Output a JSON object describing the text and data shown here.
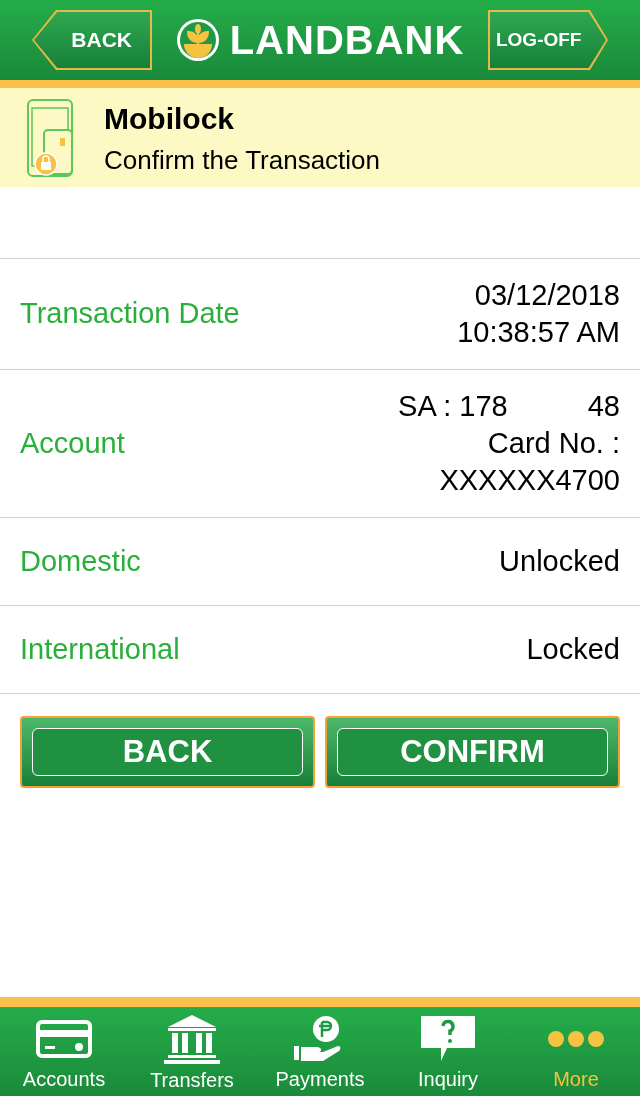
{
  "header": {
    "back": "BACK",
    "logo": "LANDBANK",
    "logoff": "LOG-OFF"
  },
  "banner": {
    "title": "Mobilock",
    "subtitle": "Confirm the Transaction"
  },
  "rows": [
    {
      "label": "Transaction Date",
      "lines": [
        [
          "03/12/2018"
        ],
        [
          "10:38:57 AM"
        ]
      ]
    },
    {
      "label": "Account",
      "lines": [
        [
          "SA : 178",
          "48"
        ],
        [
          "Card No. :"
        ],
        [
          "XXXXXX4700"
        ]
      ]
    },
    {
      "label": "Domestic",
      "lines": [
        [
          "Unlocked"
        ]
      ]
    },
    {
      "label": "International",
      "lines": [
        [
          "Locked"
        ]
      ]
    }
  ],
  "buttons": [
    "BACK",
    "CONFIRM"
  ],
  "nav": [
    {
      "kind": "card",
      "label": "Accounts",
      "selected": false
    },
    {
      "kind": "bank",
      "label": "Transfers",
      "selected": false
    },
    {
      "kind": "payment",
      "label": "Payments",
      "selected": false
    },
    {
      "kind": "inquiry",
      "label": "Inquiry",
      "selected": false
    },
    {
      "kind": "more",
      "label": "More",
      "selected": true
    }
  ]
}
